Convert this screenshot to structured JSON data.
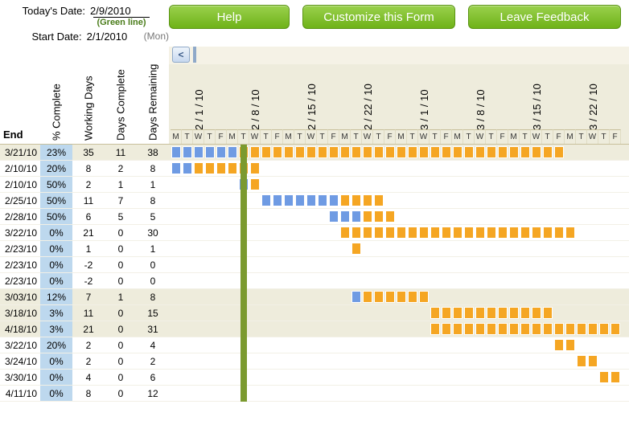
{
  "header": {
    "today_label": "Today's Date:",
    "today_value": "2/9/2010",
    "greenline": "(Green line)",
    "start_label": "Start Date:",
    "start_value": "2/1/2010",
    "start_dow": "(Mon)",
    "help": "Help",
    "customize": "Customize this Form",
    "feedback": "Leave Feedback",
    "scroll_left": "<"
  },
  "left_headers": {
    "end": "End",
    "pct": "% Complete",
    "wd": "Working Days",
    "dc": "Days Complete",
    "dr": "Days Remaining"
  },
  "week_dates": [
    "2 / 1 / 10",
    "2 / 8 / 10",
    "2 / 15 / 10",
    "2 / 22 / 10",
    "3 / 1 / 10",
    "3 / 8 / 10",
    "3 / 15 / 10",
    "3 / 22 / 10"
  ],
  "day_letters": [
    "M",
    "T",
    "W",
    "T",
    "F",
    "M",
    "T",
    "W",
    "T",
    "F",
    "M",
    "T",
    "W",
    "T",
    "F",
    "M",
    "T",
    "W",
    "T",
    "F",
    "M",
    "T",
    "W",
    "T",
    "F",
    "M",
    "T",
    "W",
    "T",
    "F",
    "M",
    "T",
    "W",
    "T",
    "F",
    "M",
    "T",
    "W",
    "T",
    "F"
  ],
  "chart_data": {
    "type": "gantt",
    "today_index": 6,
    "rows": [
      {
        "end": "3/21/10",
        "pct": "23%",
        "wd": "35",
        "dc": "11",
        "dr": "38",
        "bars": [
          {
            "start": 0,
            "len": 6,
            "state": "c"
          },
          {
            "start": 6,
            "len": 1,
            "state": "r"
          },
          {
            "start": 7,
            "len": 28,
            "state": "r"
          }
        ]
      },
      {
        "end": "2/10/10",
        "pct": "20%",
        "wd": "8",
        "dc": "2",
        "dr": "8",
        "bars": [
          {
            "start": 0,
            "len": 2,
            "state": "c"
          },
          {
            "start": 2,
            "len": 6,
            "state": "r"
          }
        ]
      },
      {
        "end": "2/10/10",
        "pct": "50%",
        "wd": "2",
        "dc": "1",
        "dr": "1",
        "bars": [
          {
            "start": 6,
            "len": 1,
            "state": "c"
          },
          {
            "start": 7,
            "len": 1,
            "state": "r"
          }
        ]
      },
      {
        "end": "2/25/10",
        "pct": "50%",
        "wd": "11",
        "dc": "7",
        "dr": "8",
        "bars": [
          {
            "start": 8,
            "len": 7,
            "state": "c"
          },
          {
            "start": 15,
            "len": 4,
            "state": "r"
          }
        ]
      },
      {
        "end": "2/28/10",
        "pct": "50%",
        "wd": "6",
        "dc": "5",
        "dr": "5",
        "bars": [
          {
            "start": 14,
            "len": 3,
            "state": "c"
          },
          {
            "start": 17,
            "len": 3,
            "state": "r"
          }
        ]
      },
      {
        "end": "3/22/10",
        "pct": "0%",
        "wd": "21",
        "dc": "0",
        "dr": "30",
        "bars": [
          {
            "start": 15,
            "len": 21,
            "state": "r"
          }
        ]
      },
      {
        "end": "2/23/10",
        "pct": "0%",
        "wd": "1",
        "dc": "0",
        "dr": "1",
        "bars": [
          {
            "start": 16,
            "len": 1,
            "state": "r"
          }
        ]
      },
      {
        "end": "2/23/10",
        "pct": "0%",
        "wd": "-2",
        "dc": "0",
        "dr": "0",
        "bars": []
      },
      {
        "end": "2/23/10",
        "pct": "0%",
        "wd": "-2",
        "dc": "0",
        "dr": "0",
        "bars": []
      },
      {
        "end": "3/03/10",
        "pct": "12%",
        "wd": "7",
        "dc": "1",
        "dr": "8",
        "bars": [
          {
            "start": 16,
            "len": 1,
            "state": "c"
          },
          {
            "start": 17,
            "len": 6,
            "state": "r"
          }
        ]
      },
      {
        "end": "3/18/10",
        "pct": "3%",
        "wd": "11",
        "dc": "0",
        "dr": "15",
        "bars": [
          {
            "start": 23,
            "len": 11,
            "state": "r"
          }
        ]
      },
      {
        "end": "4/18/10",
        "pct": "3%",
        "wd": "21",
        "dc": "0",
        "dr": "31",
        "bars": [
          {
            "start": 23,
            "len": 17,
            "state": "r"
          }
        ]
      },
      {
        "end": "3/22/10",
        "pct": "20%",
        "wd": "2",
        "dc": "0",
        "dr": "4",
        "bars": [
          {
            "start": 34,
            "len": 2,
            "state": "r"
          }
        ]
      },
      {
        "end": "3/24/10",
        "pct": "0%",
        "wd": "2",
        "dc": "0",
        "dr": "2",
        "bars": [
          {
            "start": 36,
            "len": 2,
            "state": "r"
          }
        ]
      },
      {
        "end": "3/30/10",
        "pct": "0%",
        "wd": "4",
        "dc": "0",
        "dr": "6",
        "bars": [
          {
            "start": 38,
            "len": 2,
            "state": "r"
          }
        ]
      },
      {
        "end": "4/11/10",
        "pct": "0%",
        "wd": "8",
        "dc": "0",
        "dr": "12",
        "bars": []
      }
    ]
  }
}
